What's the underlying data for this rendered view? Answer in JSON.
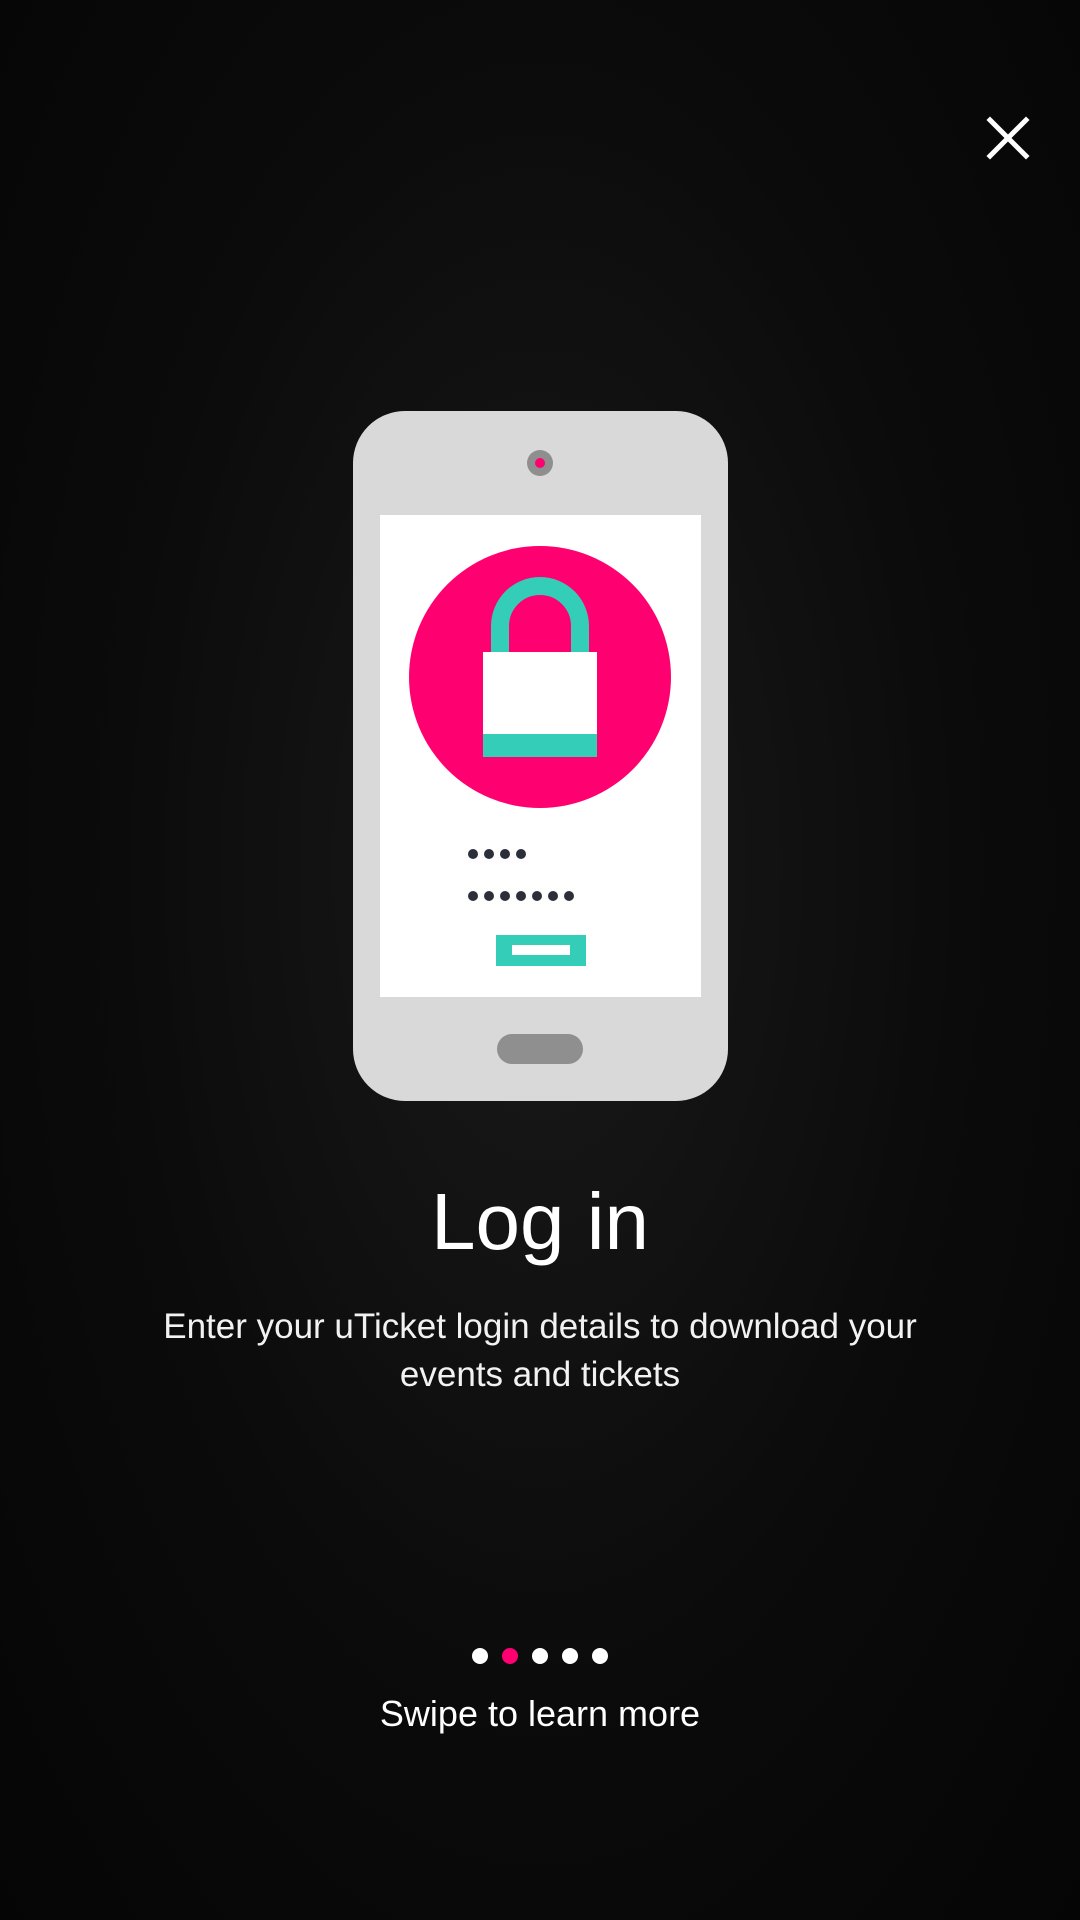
{
  "onboarding": {
    "close_icon": "close-icon",
    "illustration": "phone-login-illustration",
    "title": "Log in",
    "description": "Enter your uTicket login details to download your events and tickets",
    "pagination": {
      "total": 5,
      "active_index": 1
    },
    "hint": "Swipe to learn more"
  },
  "colors": {
    "accent_pink": "#ff0071",
    "accent_teal": "#33cdb8",
    "phone_body": "#d9d9d9",
    "phone_detail": "#8f8f8f",
    "background": "#0b0b0b",
    "text": "#ffffff"
  }
}
